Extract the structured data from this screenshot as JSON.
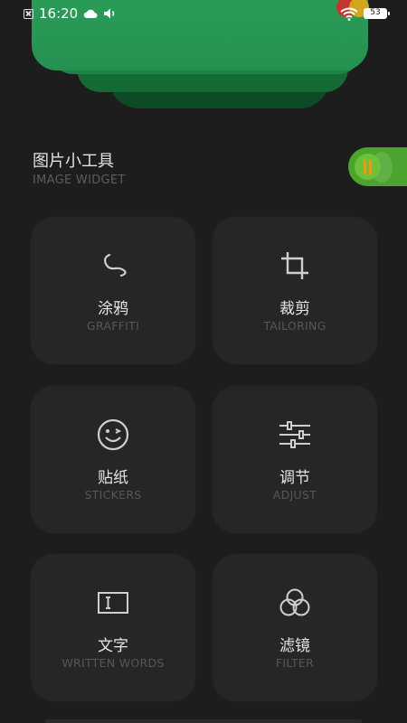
{
  "status_bar": {
    "time": "16:20",
    "battery": "53",
    "icons": [
      "notification-box-icon",
      "cloud-icon",
      "volume-icon",
      "wifi-icon",
      "battery-icon"
    ]
  },
  "card": {
    "brand_colors": [
      "#c2372f",
      "#d9a81a"
    ],
    "color": "#2fa05c"
  },
  "section": {
    "title": "图片小工具",
    "subtitle": "IMAGE WIDGET",
    "toggle_color": "#4aa42e"
  },
  "tools": [
    {
      "label": "涂鸦",
      "sub": "GRAFFITI",
      "icon": "squiggle-icon"
    },
    {
      "label": "裁剪",
      "sub": "TAILORING",
      "icon": "crop-icon"
    },
    {
      "label": "贴纸",
      "sub": "STICKERS",
      "icon": "smiley-icon"
    },
    {
      "label": "调节",
      "sub": "ADJUST",
      "icon": "sliders-icon"
    },
    {
      "label": "文字",
      "sub": "WRITTEN WORDS",
      "icon": "text-box-icon"
    },
    {
      "label": "滤镜",
      "sub": "FILTER",
      "icon": "filter-circles-icon"
    }
  ]
}
